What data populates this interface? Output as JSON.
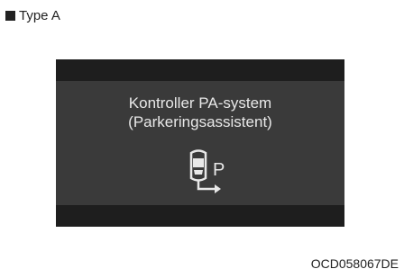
{
  "header": {
    "type_label": "Type A"
  },
  "display": {
    "message_line1": "Kontroller PA-system",
    "message_line2": "(Parkeringsassistent)",
    "icon": "parking-assist-icon",
    "icon_letter": "P"
  },
  "footer": {
    "ref_code": "OCD058067DE"
  },
  "colors": {
    "panel_outer": "#1e1e1e",
    "panel_inner": "#3a3a3a",
    "text": "#e8e8e8"
  }
}
